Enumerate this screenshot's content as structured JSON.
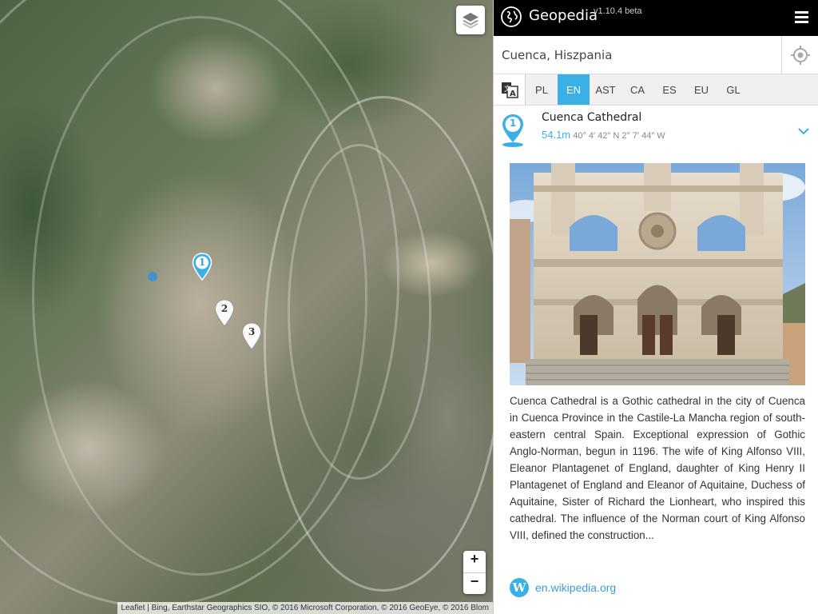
{
  "map": {
    "attribution": "Leaflet | Bing, Earthstar Geographics SIO, © 2016 Microsoft Corporation, © 2016 GeoEye, © 2016 Blom",
    "markers": [
      {
        "label": "1",
        "active": true
      },
      {
        "label": "2",
        "active": false
      },
      {
        "label": "3",
        "active": false
      }
    ],
    "zoom_in": "+",
    "zoom_out": "−",
    "layers_icon": "layers-icon"
  },
  "header": {
    "title": "Geopedia",
    "version": "v1.10.4 beta",
    "menu_icon": "hamburger-icon"
  },
  "search": {
    "value": "Cuenca, Hiszpania",
    "gps_icon": "crosshair-icon"
  },
  "languages": {
    "icon": "translate-icon",
    "tabs": [
      {
        "label": "PL"
      },
      {
        "label": "EN"
      },
      {
        "label": "AST"
      },
      {
        "label": "CA"
      },
      {
        "label": "ES"
      },
      {
        "label": "EU"
      },
      {
        "label": "GL"
      }
    ],
    "selected": "EN"
  },
  "result": {
    "number": "1",
    "title": "Cuenca Cathedral",
    "distance": "54.1m",
    "coordinates": "40° 4′ 42″ N 2° 7′ 44″ W",
    "description": "Cuenca Cathedral is a Gothic cathedral in the city of Cuenca in Cuenca Province in the Castile-La Mancha region of south-eastern central Spain. Exceptional expression of Gothic Anglo-Norman, begun in 1196. The wife of King Alfonso VIII, Eleanor Plantagenet of England, daughter of King Henry II Plantagenet of England and Eleanor of Aquitaine, Duchess of Aquitaine, Sister of Richard the Lionheart, who inspired this cathedral. The influence of the Norman court of King Alfonso VIII, defined the construction...",
    "wiki_icon": "W",
    "wiki_link": "en.wikipedia.org"
  },
  "colors": {
    "accent": "#3ab0e6",
    "header_bg": "#000000"
  }
}
